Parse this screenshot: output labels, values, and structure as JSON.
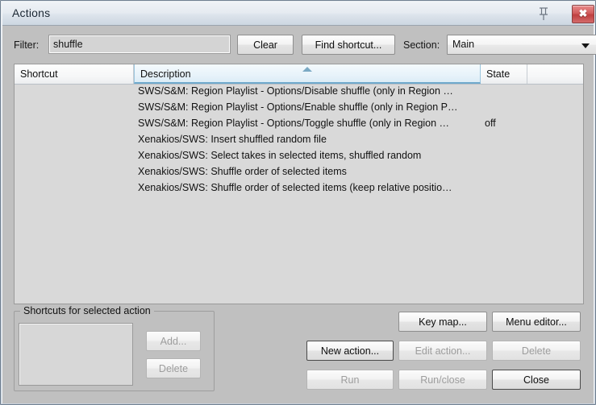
{
  "window": {
    "title": "Actions",
    "pin_icon": "pin-icon",
    "close_icon": "✖",
    "accent_close": "#bf3f3f",
    "accent_sort": "#6fa9cc",
    "background": "#c0c0c0"
  },
  "toolbar": {
    "filter_label": "Filter:",
    "filter_value": "shuffle",
    "filter_placeholder": "",
    "clear_label": "Clear",
    "find_shortcut_label": "Find shortcut...",
    "section_label": "Section:",
    "section_value": "Main",
    "section_options": [
      "Main"
    ]
  },
  "list": {
    "columns": [
      {
        "key": "shortcut",
        "label": "Shortcut",
        "sorted": false
      },
      {
        "key": "description",
        "label": "Description",
        "sorted": true
      },
      {
        "key": "state",
        "label": "State",
        "sorted": false
      },
      {
        "key": "blank",
        "label": "",
        "sorted": false
      }
    ],
    "sort_direction": "asc",
    "rows": [
      {
        "shortcut": "",
        "description": "SWS/S&M: Region Playlist - Options/Disable shuffle (only in Region …",
        "state": ""
      },
      {
        "shortcut": "",
        "description": "SWS/S&M: Region Playlist - Options/Enable shuffle (only in Region P…",
        "state": ""
      },
      {
        "shortcut": "",
        "description": "SWS/S&M: Region Playlist - Options/Toggle shuffle (only in Region …",
        "state": "off"
      },
      {
        "shortcut": "",
        "description": "Xenakios/SWS: Insert shuffled random file",
        "state": ""
      },
      {
        "shortcut": "",
        "description": "Xenakios/SWS: Select takes in selected items, shuffled random",
        "state": ""
      },
      {
        "shortcut": "",
        "description": "Xenakios/SWS: Shuffle order of selected items",
        "state": ""
      },
      {
        "shortcut": "",
        "description": "Xenakios/SWS: Shuffle order of selected items (keep relative positio…",
        "state": ""
      }
    ]
  },
  "shortcuts_group": {
    "title": "Shortcuts for selected action",
    "add_label": "Add...",
    "delete_label": "Delete",
    "items": []
  },
  "actions": {
    "key_map_label": "Key map...",
    "menu_editor_label": "Menu editor...",
    "new_action_label": "New action...",
    "edit_action_label": "Edit action...",
    "delete_label": "Delete",
    "run_label": "Run",
    "run_close_label": "Run/close",
    "close_label": "Close"
  }
}
